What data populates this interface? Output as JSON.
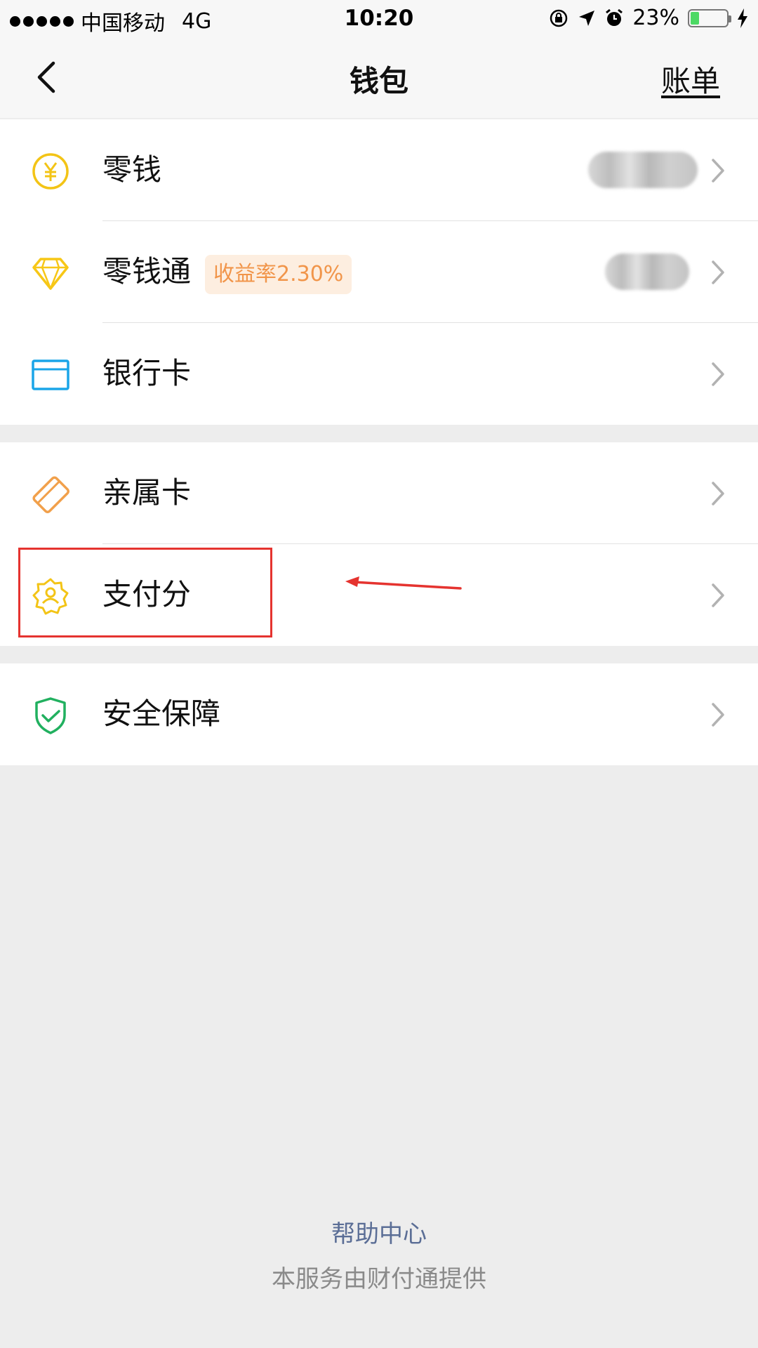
{
  "status_bar": {
    "carrier": "中国移动",
    "network": "4G",
    "time": "10:20",
    "battery": "23%",
    "battery_level": 0.23
  },
  "nav": {
    "title": "钱包",
    "bill_label": "账单"
  },
  "groups": [
    {
      "items": [
        {
          "label": "零钱",
          "icon": "yuan-coin-icon",
          "color": "#f3c416"
        },
        {
          "label": "零钱通",
          "badge": "收益率2.30%",
          "icon": "diamond-icon",
          "color": "#f7c716"
        },
        {
          "label": "银行卡",
          "icon": "bank-card-icon",
          "color": "#1aa5e8"
        }
      ]
    },
    {
      "items": [
        {
          "label": "亲属卡",
          "icon": "family-card-icon",
          "color": "#f1a04b"
        },
        {
          "label": "支付分",
          "icon": "pay-score-icon",
          "color": "#f3c416"
        }
      ]
    },
    {
      "items": [
        {
          "label": "安全保障",
          "icon": "shield-check-icon",
          "color": "#21b05f"
        }
      ]
    }
  ],
  "footer": {
    "help": "帮助中心",
    "provider": "本服务由财付通提供"
  },
  "annotation": {
    "highlight_color": "#e5332f"
  }
}
